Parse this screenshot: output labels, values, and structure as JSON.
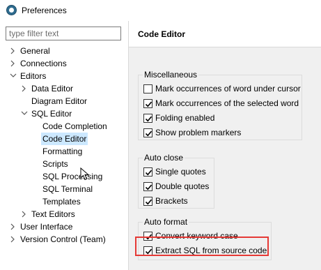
{
  "window": {
    "title": "Preferences"
  },
  "filter": {
    "placeholder": "type filter text"
  },
  "tree": {
    "general": "General",
    "connections": "Connections",
    "editors": "Editors",
    "data_editor": "Data Editor",
    "diagram_editor": "Diagram Editor",
    "sql_editor": "SQL Editor",
    "code_completion": "Code Completion",
    "code_editor": "Code Editor",
    "formatting": "Formatting",
    "scripts": "Scripts",
    "sql_processing": "SQL Processing",
    "sql_terminal": "SQL Terminal",
    "templates": "Templates",
    "text_editors": "Text Editors",
    "user_interface": "User Interface",
    "version_control": "Version Control (Team)"
  },
  "page": {
    "title": "Code Editor"
  },
  "groups": {
    "misc": {
      "title": "Miscellaneous",
      "items": [
        {
          "label": "Mark occurrences of word under cursor",
          "checked": false
        },
        {
          "label": "Mark occurrences of the selected word",
          "checked": true
        },
        {
          "label": "Folding enabled",
          "checked": true
        },
        {
          "label": "Show problem markers",
          "checked": true
        }
      ]
    },
    "auto_close": {
      "title": "Auto close",
      "items": [
        {
          "label": "Single quotes",
          "checked": true
        },
        {
          "label": "Double quotes",
          "checked": true
        },
        {
          "label": "Brackets",
          "checked": true
        }
      ]
    },
    "auto_format": {
      "title": "Auto format",
      "items": [
        {
          "label": "Convert keyword case",
          "checked": true
        },
        {
          "label": "Extract SQL from source code",
          "checked": true
        }
      ]
    }
  },
  "colors": {
    "selection": "#cce8ff",
    "highlight": "#e53935",
    "page_bg": "#f0f0f0"
  }
}
